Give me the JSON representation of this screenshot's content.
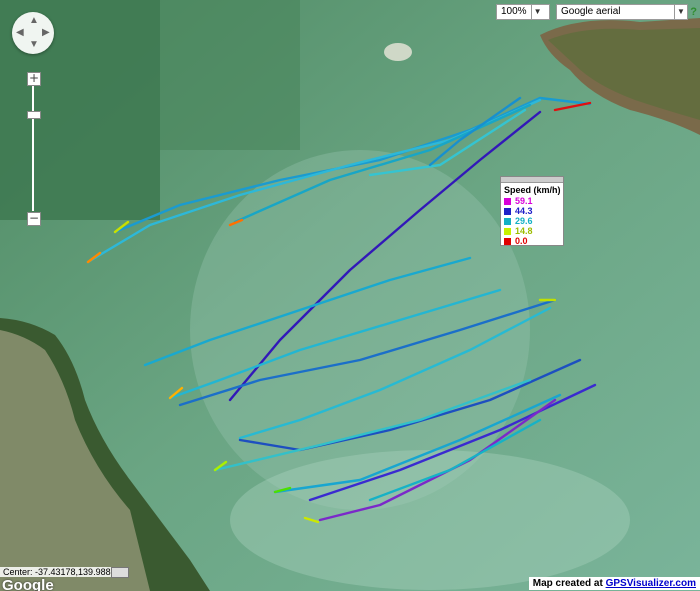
{
  "map": {
    "zoom_select": "100%",
    "map_type_select": "Google aerial",
    "help_label": "?",
    "center_label": "Center: -37.43178,139.98896",
    "google_logo": "Google",
    "credit_prefix": "Map created at ",
    "credit_link": "GPSVisualizer.com"
  },
  "legend": {
    "title": "Speed (km/h)",
    "entries": [
      {
        "label": "59.1",
        "color": "#d900d9"
      },
      {
        "label": "44.3",
        "color": "#2020c8"
      },
      {
        "label": "29.6",
        "color": "#12b0c4"
      },
      {
        "label": "14.8",
        "color": "#c8f000"
      },
      {
        "label": "0.0",
        "color": "#e00000"
      }
    ]
  },
  "icons": {
    "pan": "pan-control-icon",
    "zoom_in": "zoom-in-icon",
    "zoom_out": "zoom-out-icon",
    "dropdown": "chevron-down-icon"
  },
  "colors": {
    "water": "#5d9a78",
    "track_primary": "#1a8fd0"
  }
}
